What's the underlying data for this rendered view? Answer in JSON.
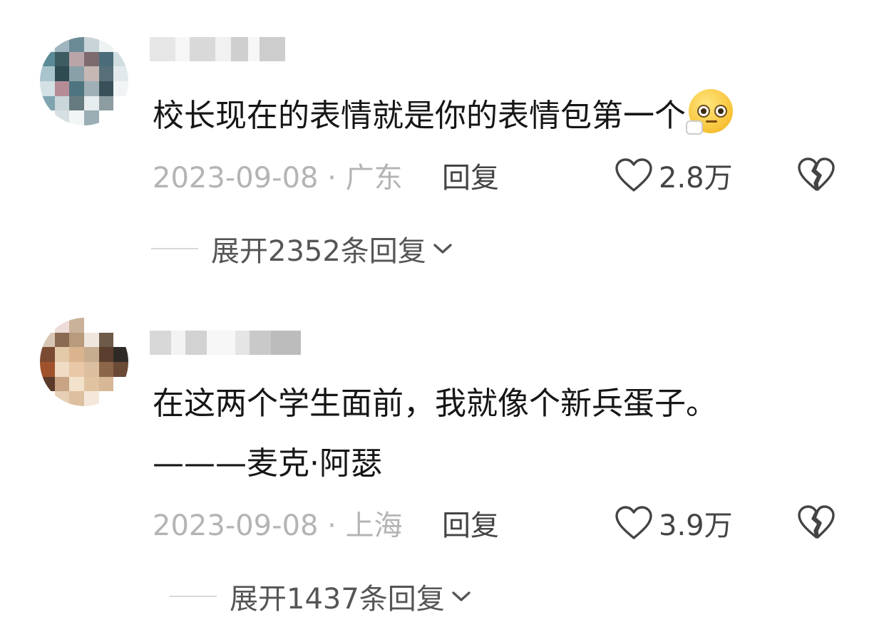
{
  "comments": [
    {
      "text_lines": [
        "校长现在的表情就是你的表情包第一个"
      ],
      "emoji_icon": "pleading-face-icon",
      "date": "2023-09-08 · 广东",
      "reply_label": "回复",
      "likes": "2.8万",
      "expand_label": "展开2352条回复",
      "avatar_colors": [
        "#e9eef0",
        "#9fb5bf",
        "#6a8a96",
        "#c8d4d8",
        "#eef2f3",
        "#ffffff",
        "#5a8a95",
        "#3d5c62",
        "#b9a4a8",
        "#7c6a6e",
        "#4a6c78",
        "#d0dde1",
        "#a8c4cc",
        "#2f4b52",
        "#8aa0a8",
        "#c5b8b4",
        "#566f78",
        "#e2e9ec",
        "#d3e0e4",
        "#b58c96",
        "#4e7480",
        "#9fb1b6",
        "#3a5058",
        "#f0f4f5",
        "#7fa4b0",
        "#c9d6da",
        "#667b80",
        "#e7ecee",
        "#8c9ca0",
        "#ffffff",
        "#ffffff",
        "#d6dfe2",
        "#f2f5f6",
        "#9aaeb3",
        "#ffffff",
        "#ffffff"
      ]
    },
    {
      "text_lines": [
        "在这两个学生面前，我就像个新兵蛋子。",
        "———麦克·阿瑟"
      ],
      "date": "2023-09-08 · 上海",
      "reply_label": "回复",
      "likes": "3.9万",
      "expand_label": "展开1437条回复",
      "avatar_colors": [
        "#ffffff",
        "#eedcd8",
        "#c9b19a",
        "#ffffff",
        "#ffffff",
        "#ffffff",
        "#d8c6b4",
        "#8a6a50",
        "#b89a7c",
        "#efe6de",
        "#6d5a48",
        "#ffffff",
        "#7a4a32",
        "#e4c9a8",
        "#d9b48f",
        "#c7ad90",
        "#5c3e2e",
        "#2f2a26",
        "#a0522d",
        "#f0dcc4",
        "#e8c8a6",
        "#dcbf9e",
        "#8c6648",
        "#6a4a36",
        "#5a3a28",
        "#c9a484",
        "#f2e2cc",
        "#e0c4a2",
        "#d6b896",
        "#ffffff",
        "#ffffff",
        "#e6cfb4",
        "#dcc0a0",
        "#f4e8da",
        "#ffffff",
        "#ffffff"
      ]
    }
  ],
  "colors": {
    "meta_gray": "#b4b4b4",
    "text_dark": "#161616",
    "action_gray": "#444444"
  }
}
